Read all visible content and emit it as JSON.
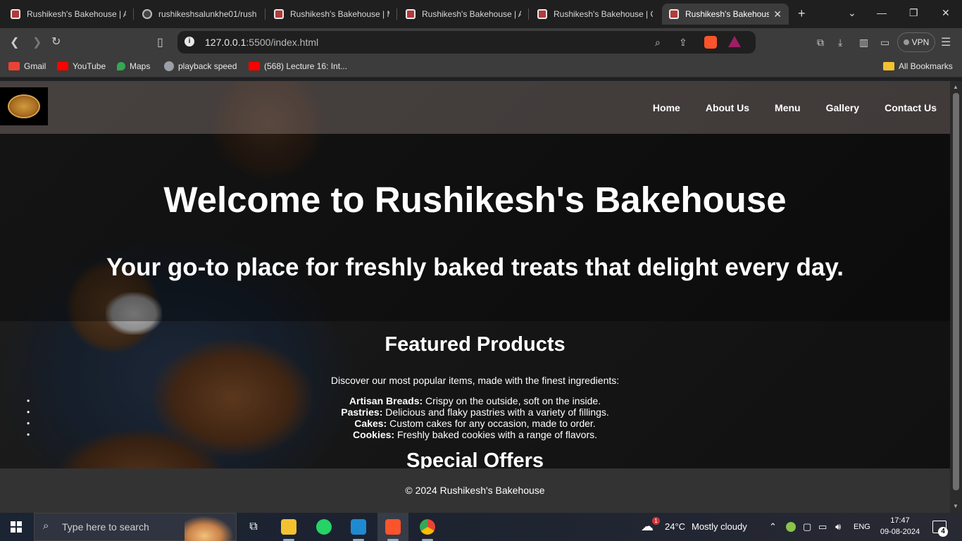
{
  "browser": {
    "tabs": [
      {
        "title": "Rushikesh's Bakehouse | A",
        "favicon": "bakery-icon"
      },
      {
        "title": "rushikeshsalunkhe01/rush",
        "favicon": "github-icon"
      },
      {
        "title": "Rushikesh's Bakehouse | M",
        "favicon": "bakery-icon"
      },
      {
        "title": "Rushikesh's Bakehouse | A",
        "favicon": "bakery-icon"
      },
      {
        "title": "Rushikesh's Bakehouse | G",
        "favicon": "bakery-icon"
      },
      {
        "title": "Rushikesh's Bakehouse",
        "favicon": "bakery-icon",
        "active": true
      }
    ],
    "url": {
      "host": "127.0.0.1",
      "path": ":5500/index.html"
    },
    "vpn_label": "VPN",
    "bookmarks": [
      {
        "label": "Gmail",
        "icon": "gmail-icon",
        "color": "#ea4335"
      },
      {
        "label": "YouTube",
        "icon": "youtube-icon",
        "color": "#ff0000"
      },
      {
        "label": "Maps",
        "icon": "maps-icon",
        "color": "#34a853"
      },
      {
        "label": "playback speed",
        "icon": "globe-icon",
        "color": "#9aa0a6"
      },
      {
        "label": "(568) Lecture 16: Int...",
        "icon": "youtube-icon",
        "color": "#ff0000"
      }
    ],
    "all_bookmarks": "All Bookmarks"
  },
  "site": {
    "nav": [
      "Home",
      "About Us",
      "Menu",
      "Gallery",
      "Contact Us"
    ],
    "hero": {
      "title": "Welcome to Rushikesh's Bakehouse",
      "subtitle": "Your go-to place for freshly baked treats that delight every day."
    },
    "featured": {
      "heading": "Featured Products",
      "intro": "Discover our most popular items, made with the finest ingredients:",
      "items": [
        {
          "name": "Artisan Breads:",
          "desc": " Crispy on the outside, soft on the inside."
        },
        {
          "name": "Pastries:",
          "desc": " Delicious and flaky pastries with a variety of fillings."
        },
        {
          "name": "Cakes:",
          "desc": " Custom cakes for any occasion, made to order."
        },
        {
          "name": "Cookies:",
          "desc": " Freshly baked cookies with a range of flavors."
        }
      ],
      "offers_heading": "Special Offers"
    },
    "footer": "© 2024 Rushikesh's Bakehouse"
  },
  "taskbar": {
    "search_placeholder": "Type here to search",
    "weather": {
      "temp": "24°C",
      "condition": "Mostly cloudy",
      "badge": "1"
    },
    "language": "ENG",
    "time": "17:47",
    "date": "09-08-2024",
    "notification_count": "4"
  }
}
